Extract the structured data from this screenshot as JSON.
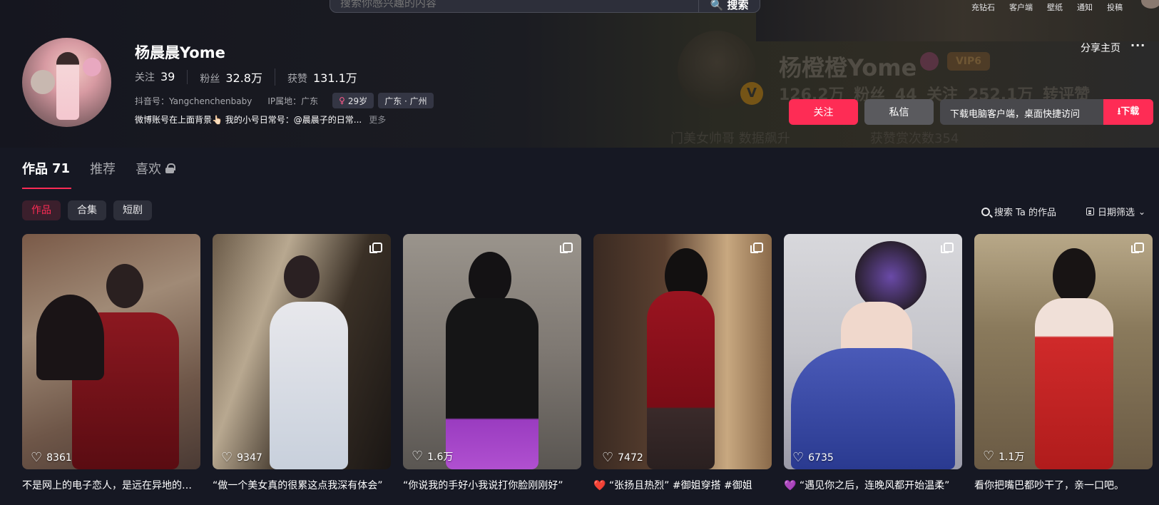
{
  "topnav": {
    "search_placeholder": "搜索你感兴趣的内容",
    "search_button": "搜索",
    "links": [
      "充钻石",
      "客户端",
      "壁纸",
      "通知",
      "投稿"
    ]
  },
  "banner_ghost": {
    "name": "杨橙橙Yome",
    "vip": "VIP6",
    "stats": "126.2万 粉丝   44 关注   252.1万 转评赞",
    "line1": "门美女帅哥 数据飙升",
    "line2": "获赞赏次数354"
  },
  "profile": {
    "name": "杨晨晨Yome",
    "following_label": "关注",
    "following_value": "39",
    "followers_label": "粉丝",
    "followers_value": "32.8万",
    "likes_label": "获赞",
    "likes_value": "131.1万",
    "douyin_id": "抖音号：Yangchenchenbaby",
    "ip_location": "IP属地：广东",
    "age_tag": "29岁",
    "region_tag": "广东 · 广州",
    "bio": "微博账号在上面背景👆🏻 我的小号日常号：@晨晨子的日常...",
    "bio_more": "更多"
  },
  "actions": {
    "share": "分享主页",
    "more": "···",
    "follow": "关注",
    "message": "私信",
    "download_text": "下载电脑客户端，桌面快捷访问",
    "download_button": "下载"
  },
  "tabs": [
    {
      "label": "作品",
      "count": "71"
    },
    {
      "label": "推荐"
    },
    {
      "label": "喜欢"
    }
  ],
  "chips": [
    "作品",
    "合集",
    "短剧"
  ],
  "tools": {
    "search_works": "搜索 Ta 的作品",
    "date_filter": "日期筛选"
  },
  "videos": [
    {
      "likes": "8361",
      "caption": "不是网上的电子恋人，是远在异地的真实恋人"
    },
    {
      "likes": "9347",
      "caption": "“做一个美女真的很累这点我深有体会”"
    },
    {
      "likes": "1.6万",
      "caption": "“你说我的手好小我说打你脸刚刚好”"
    },
    {
      "likes": "7472",
      "caption": "❤️ “张扬且热烈” #御姐穿搭 #御姐"
    },
    {
      "likes": "6735",
      "caption": "💜 “遇见你之后，连晚风都开始温柔”"
    },
    {
      "likes": "1.1万",
      "caption": "看你把嘴巴都吵干了，亲一口吧。"
    }
  ]
}
